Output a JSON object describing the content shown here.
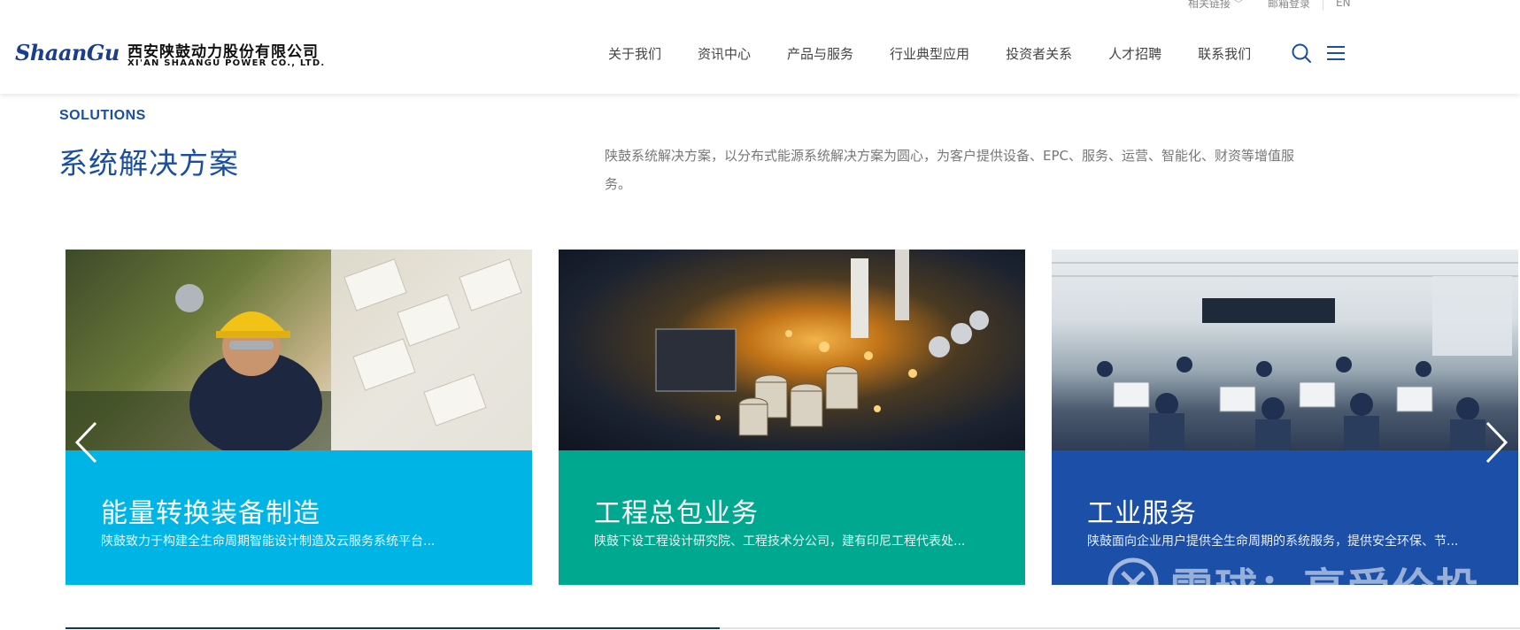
{
  "topbar": {
    "links_label": "相关链接",
    "mail_label": "邮箱登录",
    "lang_label": "EN"
  },
  "logo": {
    "mark": "ShaanGu",
    "name_cn": "西安陕鼓动力股份有限公司",
    "name_en": "XI'AN SHAANGU POWER CO., LTD."
  },
  "nav": {
    "items": [
      {
        "label": "关于我们"
      },
      {
        "label": "资讯中心"
      },
      {
        "label": "产品与服务"
      },
      {
        "label": "行业典型应用"
      },
      {
        "label": "投资者关系"
      },
      {
        "label": "人才招聘"
      },
      {
        "label": "联系我们"
      }
    ],
    "search_icon": "search-icon",
    "menu_icon": "menu-icon"
  },
  "solutions": {
    "en_title": "SOLUTIONS",
    "cn_title": "系统解决方案",
    "description": "陕鼓系统解决方案，以分布式能源系统解决方案为圆心，为客户提供设备、EPC、服务、运营、智能化、财资等增值服务。"
  },
  "cards": [
    {
      "title": "能量转换装备制造",
      "subtitle": "陕鼓致力于构建全生命周期智能设计制造及云服务系统平台...",
      "color": "#00b5e5"
    },
    {
      "title": "工程总包业务",
      "subtitle": "陕鼓下设工程设计研究院、工程技术分公司，建有印尼工程代表处...",
      "color": "#00a88f"
    },
    {
      "title": "工业服务",
      "subtitle": "陕鼓面向企业用户提供全生命周期的系统服务，提供安全环保、节...",
      "color": "#1b4fa8"
    }
  ],
  "carousel": {
    "prev_icon": "chevron-left-icon",
    "next_icon": "chevron-right-icon",
    "progress": 0.45
  },
  "watermark": {
    "text": "雪球：享受价投"
  }
}
